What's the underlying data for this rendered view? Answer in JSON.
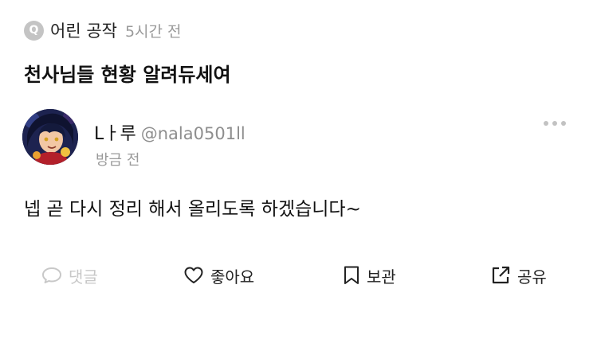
{
  "question": {
    "badge": "Q",
    "author": "어린 공작",
    "time": "5시간 전",
    "title": "천사님들 현황 알려듀세여"
  },
  "answer": {
    "author_name": "Lㅏ루",
    "author_handle": "@nala0501ll",
    "time": "방금 전",
    "body": "넵 곧 다시 정리 해서 올리도록 하겠습니다~"
  },
  "actions": {
    "comment": "댓글",
    "like": "좋아요",
    "save": "보관",
    "share": "공유"
  },
  "icons": {
    "comment": "speech-bubble-icon",
    "like": "heart-icon",
    "save": "bookmark-icon",
    "share": "share-external-icon",
    "more": "more-horizontal-icon"
  },
  "colors": {
    "muted_text": "#9a9a9a",
    "disabled": "#c8c8c8",
    "badge_bg": "#c4c4c4"
  }
}
